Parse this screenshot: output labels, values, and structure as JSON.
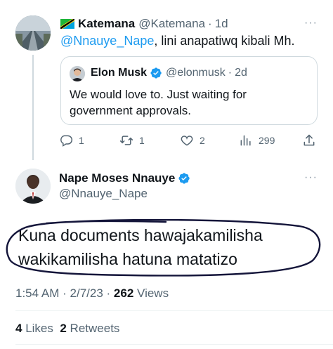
{
  "reply_tweet": {
    "author_name": "Katemana",
    "author_handle": "@Katemana",
    "separator": "·",
    "time": "1d",
    "mention": "@Nnauye_Nape",
    "text": ", lini anapatiwq kibali Mh.",
    "more_label": "···",
    "quoted": {
      "author_name": "Elon Musk",
      "author_handle": "@elonmusk",
      "separator": "·",
      "time": "2d",
      "text": "We would love to. Just waiting for government approvals."
    },
    "actions": {
      "reply_count": "1",
      "retweet_count": "1",
      "like_count": "2",
      "view_count": "299"
    }
  },
  "main_tweet": {
    "author_name": "Nape Moses Nnauye",
    "author_handle": "@Nnauye_Nape",
    "more_label": "···",
    "text_line1": "Kuna documents hawajakamilisha",
    "text_line2": "wakikamilisha hatuna matatizo",
    "time": "1:54 AM",
    "separator": "·",
    "date": "2/7/23",
    "views_count": "262",
    "views_label": "Views",
    "likes_count": "4",
    "likes_label": "Likes",
    "retweets_count": "2",
    "retweets_label": "Retweets"
  },
  "colors": {
    "accent": "#1d9bf0",
    "secondary_text": "#536471",
    "border": "#cfd9de",
    "annotation_ink": "#14153a"
  }
}
